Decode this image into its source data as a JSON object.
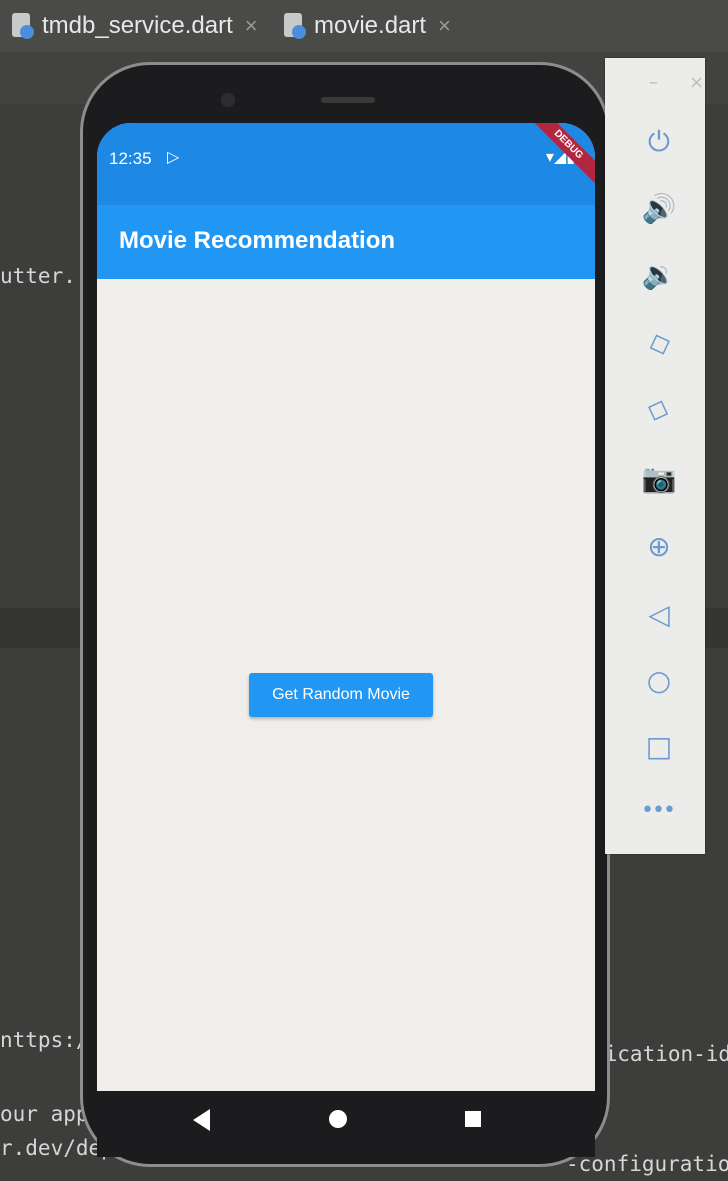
{
  "ide": {
    "tabs": [
      {
        "label": "tmdb_service.dart",
        "close": "×"
      },
      {
        "label": "movie.dart",
        "close": "×"
      }
    ],
    "code_fragments": {
      "line1": "utter.",
      "line2": "nttps:/",
      "line3": "our app",
      "line4": "r.dev/dep",
      "line5": "Lication-id",
      "line6": "-configuration"
    }
  },
  "phone": {
    "status_time": "12:35",
    "status_play": "▷",
    "status_icons": "▾◢▮",
    "debug_banner": "DEBUG",
    "app_title": "Movie Recommendation",
    "button_label": "Get Random Movie",
    "colors": {
      "appbar": "#2196f3",
      "statusbar": "#1e88e5",
      "background": "#efeeea"
    }
  },
  "emulator_toolbar": {
    "minimize": "–",
    "close": "×",
    "buttons": [
      {
        "icon": "power-icon",
        "glyph": "⏻"
      },
      {
        "icon": "volume-up-icon",
        "glyph": "🔊"
      },
      {
        "icon": "volume-down-icon",
        "glyph": "🔉"
      },
      {
        "icon": "rotate-left-icon",
        "glyph": "◇"
      },
      {
        "icon": "rotate-right-icon",
        "glyph": "◇"
      },
      {
        "icon": "camera-icon",
        "glyph": "📷"
      },
      {
        "icon": "zoom-icon",
        "glyph": "⊕"
      },
      {
        "icon": "back-icon",
        "glyph": "◁"
      },
      {
        "icon": "home-icon",
        "glyph": "○"
      },
      {
        "icon": "overview-icon",
        "glyph": "□"
      }
    ],
    "more": "•••"
  }
}
